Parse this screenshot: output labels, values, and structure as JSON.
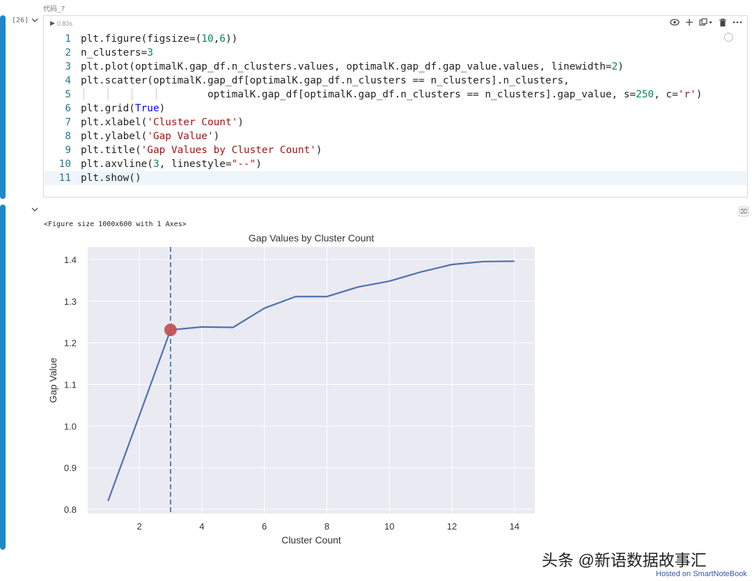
{
  "cell": {
    "title": "代码_7",
    "exec_count": "[26]",
    "run_time": "0.83s",
    "code_lines": [
      {
        "n": "1",
        "html": "plt.figure(figsize=(<span class=\"num\">10</span>,<span class=\"num\">6</span>))"
      },
      {
        "n": "2",
        "html": "n_clusters=<span class=\"num\">3</span>"
      },
      {
        "n": "3",
        "html": "plt.plot(optimalK.gap_df.n_clusters.values, optimalK.gap_df.gap_value.values, linewidth=<span class=\"num\">2</span>)"
      },
      {
        "n": "4",
        "html": "plt.scatter(optimalK.gap_df[optimalK.gap_df.n_clusters == n_clusters].n_clusters,"
      },
      {
        "n": "5",
        "html": "<span class=\"guides\">│   │   │   │   </span>     optimalK.gap_df[optimalK.gap_df.n_clusters == n_clusters].gap_value, s=<span class=\"num\">250</span>, c=<span class=\"str\">'r'</span>)"
      },
      {
        "n": "6",
        "html": "plt.grid(<span class=\"kw\">True</span>)"
      },
      {
        "n": "7",
        "html": "plt.xlabel(<span class=\"str\">'Cluster Count'</span>)"
      },
      {
        "n": "8",
        "html": "plt.ylabel(<span class=\"str\">'Gap Value'</span>)"
      },
      {
        "n": "9",
        "html": "plt.title(<span class=\"str\">'Gap Values by Cluster Count'</span>)"
      },
      {
        "n": "10",
        "html": "plt.axvline(<span class=\"num\">3</span>, linestyle=<span class=\"str\">\"--\"</span>)"
      },
      {
        "n": "11",
        "html": "plt.show()"
      }
    ]
  },
  "toolbar_icons": [
    "eye-icon",
    "plus-icon",
    "copy-dropdown-icon",
    "trash-icon",
    "more-icon"
  ],
  "output": {
    "figure_label": "<Figure size 1000x600 with 1 Axes>"
  },
  "chart_data": {
    "type": "line",
    "title": "Gap Values by Cluster Count",
    "xlabel": "Cluster Count",
    "ylabel": "Gap Value",
    "x": [
      1,
      2,
      3,
      4,
      5,
      6,
      7,
      8,
      9,
      10,
      11,
      12,
      13,
      14
    ],
    "y": [
      0.82,
      1.025,
      1.231,
      1.238,
      1.237,
      1.283,
      1.311,
      1.311,
      1.334,
      1.348,
      1.37,
      1.388,
      1.395,
      1.396
    ],
    "highlight_point": {
      "x": 3,
      "y": 1.231
    },
    "vline_x": 3,
    "xlim": [
      0.35,
      14.65
    ],
    "ylim": [
      0.79,
      1.43
    ],
    "xticks": [
      2,
      4,
      6,
      8,
      10,
      12,
      14
    ],
    "yticks": [
      0.8,
      0.9,
      1.0,
      1.1,
      1.2,
      1.3,
      1.4
    ],
    "grid": true,
    "colors": {
      "line": "#4c72b0",
      "point": "#c44e52",
      "background": "#eaeaf2",
      "grid": "#ffffff"
    }
  },
  "footer": {
    "watermark": "头条 @新语数据故事汇",
    "hosted": "Hosted on SmartNoteBook"
  }
}
